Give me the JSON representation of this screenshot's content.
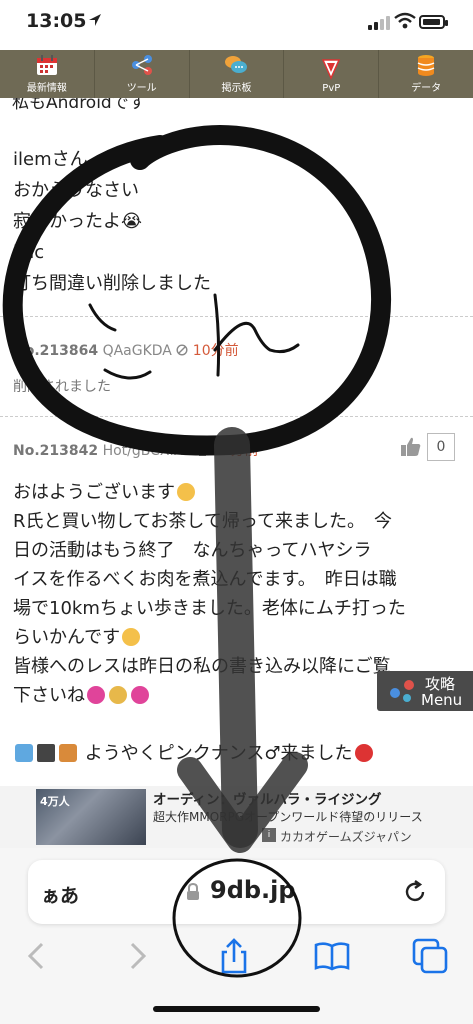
{
  "status": {
    "time": "13:05"
  },
  "nav": {
    "items": [
      {
        "label": "最新情報",
        "icon": "calendar-icon"
      },
      {
        "label": "ツール",
        "icon": "share-nodes-icon"
      },
      {
        "label": "掲示板",
        "icon": "chat-bubbles-icon"
      },
      {
        "label": "PvP",
        "icon": "shield-badge-icon"
      },
      {
        "label": "データ",
        "icon": "database-icon"
      }
    ]
  },
  "post1": {
    "cut_line": "私もAndroidです",
    "lines": [
      "ilemさん",
      "おかえりなさい",
      "寂しかったよ😭",
      "kuc",
      "打ち間違い削除しました"
    ]
  },
  "post_deleted": {
    "number": "No.213864",
    "user": "QAaGKDA",
    "time": "10分前",
    "body": "削除されました"
  },
  "post2": {
    "number": "No.213842",
    "user": "Hot/gBCXIXA",
    "time": "39分前",
    "likes": "0",
    "lines": [
      "おはようございます",
      "R氏と買い物してお茶して帰って来ました。　今",
      "日の活動はもう終了　なんちゃってハヤシラ",
      "イスを作るべくお肉を煮込んでます。　昨日は職",
      "場で10kmちょい歩きました。老体にムチ打った",
      "らいかんです",
      "皆様へのレスは昨日の私の書き込み以降にご覧",
      "下さいね"
    ],
    "last_line": "ようやくピンクナンス♂来ました"
  },
  "menu": {
    "line1": "攻略",
    "line2": "Menu"
  },
  "ad": {
    "thumb_text": "4万人",
    "title": "オーディン：ヴァルハラ・ライジング",
    "desc": "超大作MMORPGオープンワールド待望のリリース",
    "advertiser": "カカオゲームズジャパン",
    "badge": "i"
  },
  "browser": {
    "aa": "ぁあ",
    "domain": "9db.jp"
  }
}
